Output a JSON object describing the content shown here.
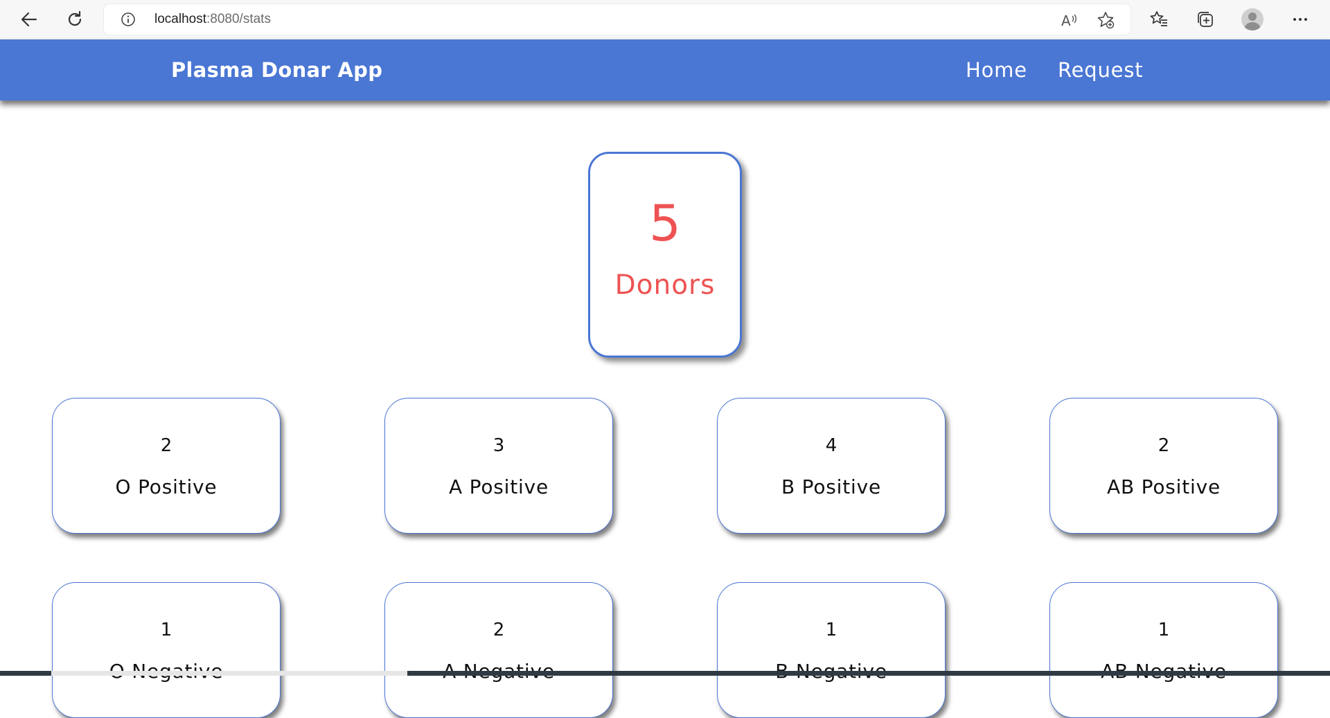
{
  "browser": {
    "url_host": "localhost",
    "url_path": ":8080/stats",
    "icons": [
      "back-icon",
      "reload-icon",
      "info-icon",
      "read-aloud-icon",
      "favorite-add-icon",
      "favorites-icon",
      "collections-icon",
      "profile-icon",
      "more-icon"
    ]
  },
  "navbar": {
    "brand": "Plasma Donar App",
    "links": [
      "Home",
      "Request"
    ],
    "color": "#4a76d4"
  },
  "summary": {
    "count": "5",
    "label": "Donors",
    "color": "#ee5252"
  },
  "groups": [
    {
      "count": "2",
      "label": "O Positive"
    },
    {
      "count": "3",
      "label": "A Positive"
    },
    {
      "count": "4",
      "label": "B Positive"
    },
    {
      "count": "2",
      "label": "AB Positive"
    },
    {
      "count": "1",
      "label": "O Negative"
    },
    {
      "count": "2",
      "label": "A Negative"
    },
    {
      "count": "1",
      "label": "B Negative"
    },
    {
      "count": "1",
      "label": "AB Negative"
    }
  ]
}
